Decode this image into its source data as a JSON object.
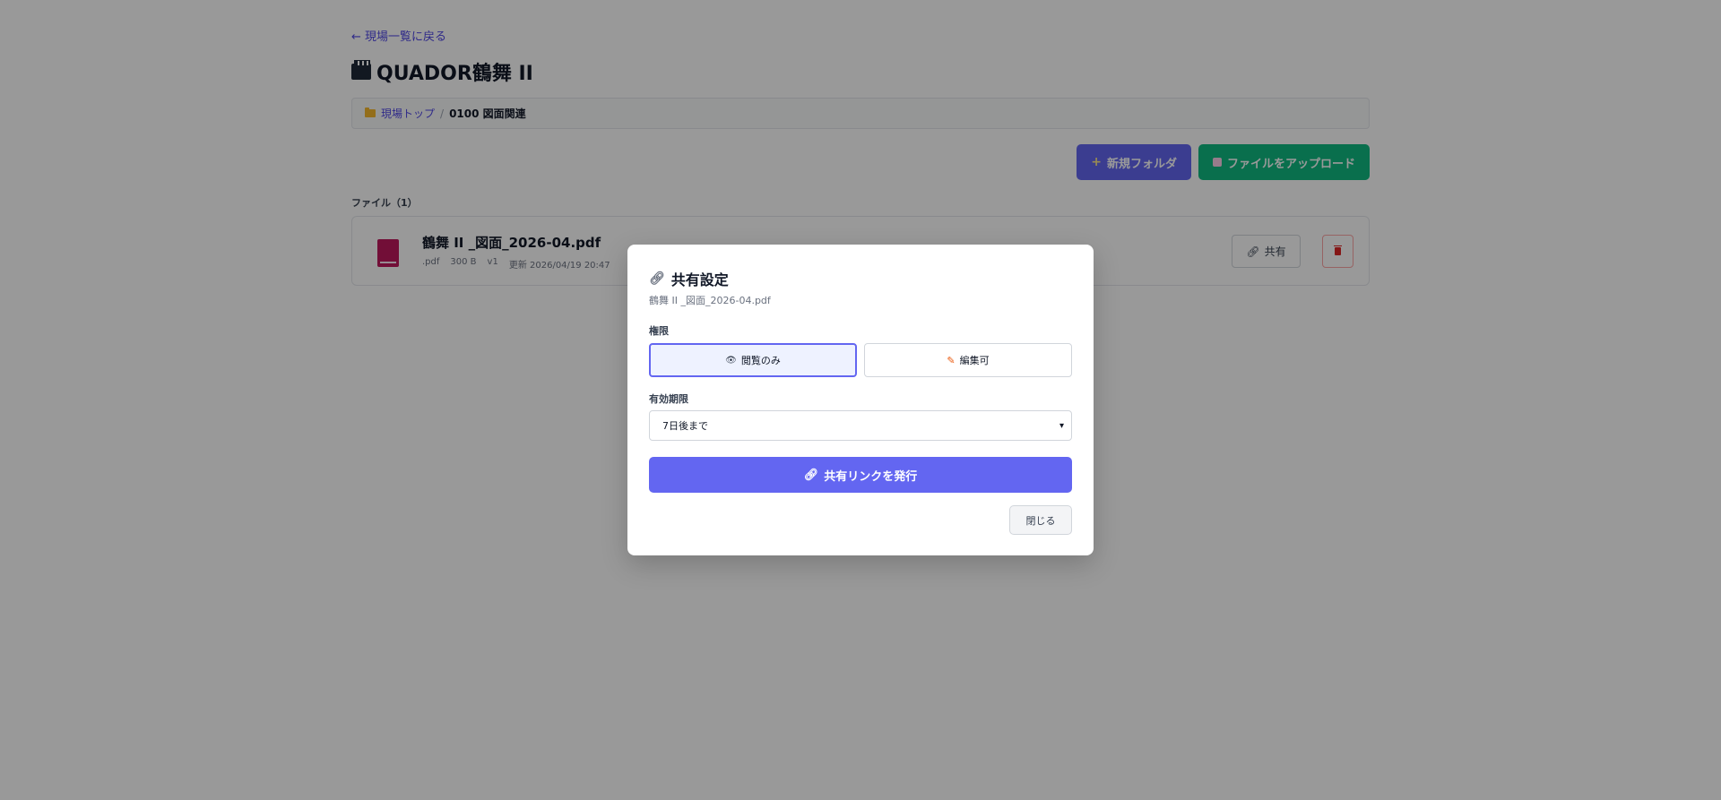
{
  "nav": {
    "back_label": "← 現場一覧に戻る"
  },
  "site": {
    "title": "QUADOR鶴舞 II"
  },
  "breadcrumb": {
    "root": "現場トップ",
    "separator": "/",
    "current": "0100 図面関連"
  },
  "toolbar": {
    "new_folder_label": "新規フォルダ",
    "upload_label": "ファイルをアップロード"
  },
  "files": {
    "header": "ファイル（1）",
    "items": [
      {
        "name": "鶴舞 II _図面_2026-04.pdf",
        "ext": ".pdf",
        "size": "300 B",
        "version": "v1",
        "updated": "更新 2026/04/19 20:47",
        "share_label": "共有"
      }
    ]
  },
  "share_modal": {
    "title": "共有設定",
    "file_name": "鶴舞 II _図面_2026-04.pdf",
    "permission_label": "権限",
    "permission_options": [
      "閲覧のみ",
      "編集可"
    ],
    "selected_permission": "閲覧のみ",
    "expiry_label": "有効期限",
    "expiry_value": "7日後まで",
    "issue_label": "共有リンクを発行",
    "close_label": "閉じる"
  },
  "colors": {
    "accent": "#6366f1",
    "success": "#10b981",
    "danger": "#dc2626"
  }
}
